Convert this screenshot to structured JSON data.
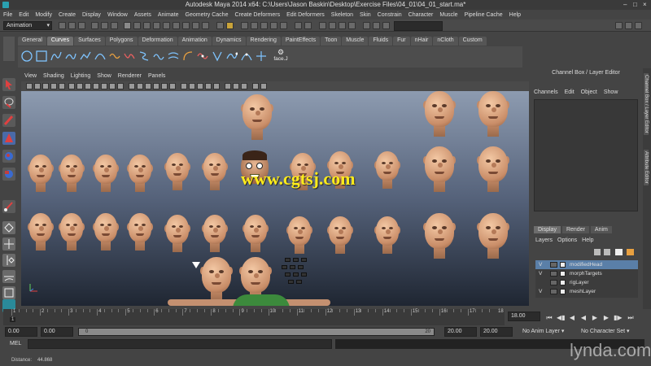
{
  "window": {
    "title": "Autodesk Maya 2014 x64: C:\\Users\\Jason Baskin\\Desktop\\Exercise Files\\04_01\\04_01_start.ma*"
  },
  "menubar": [
    "File",
    "Edit",
    "Modify",
    "Create",
    "Display",
    "Window",
    "Assets",
    "Animate",
    "Geometry Cache",
    "Create Deformers",
    "Edit Deformers",
    "Skeleton",
    "Skin",
    "Constrain",
    "Character",
    "Muscle",
    "Pipeline Cache",
    "Help"
  ],
  "statusline": {
    "mode": "Animation"
  },
  "shelf": {
    "tabs": [
      "General",
      "Curves",
      "Surfaces",
      "Polygons",
      "Deformation",
      "Animation",
      "Dynamics",
      "Rendering",
      "PaintEffects",
      "Toon",
      "Muscle",
      "Fluids",
      "Fur",
      "nHair",
      "nCloth",
      "Custom"
    ],
    "active_tab": "Curves",
    "last_item_label": "face.J"
  },
  "viewport": {
    "menu": [
      "View",
      "Shading",
      "Lighting",
      "Show",
      "Renderer",
      "Panels"
    ],
    "watermark": "www.cgtsj.com"
  },
  "channel_box": {
    "title": "Channel Box / Layer Editor",
    "menu": [
      "Channels",
      "Edit",
      "Object",
      "Show"
    ]
  },
  "layer_editor": {
    "tabs": [
      "Display",
      "Render",
      "Anim"
    ],
    "active_tab": "Display",
    "menu": [
      "Layers",
      "Options",
      "Help"
    ],
    "layers": [
      {
        "vis": "V",
        "name": "modifiedHead",
        "selected": true
      },
      {
        "vis": "V",
        "name": "morphTargets",
        "selected": false
      },
      {
        "vis": "",
        "name": "rigLayer",
        "selected": false
      },
      {
        "vis": "V",
        "name": "meshLayer",
        "selected": false
      }
    ]
  },
  "right_tabs": [
    "Channel Box / Layer Editor",
    "Attribute Editor"
  ],
  "timeline": {
    "tick_labels": [
      "1",
      "2",
      "3",
      "4",
      "5",
      "6",
      "7",
      "8",
      "9",
      "10",
      "11",
      "12",
      "13",
      "14",
      "15",
      "16",
      "17",
      "18"
    ],
    "current_frame_display": "1",
    "end_field": "18.00"
  },
  "range": {
    "start": "0.00",
    "playback_start": "0.00",
    "range_start_label": "0",
    "range_end_label": "20",
    "playback_end": "20.00",
    "end": "20.00",
    "anim_layer": "No Anim Layer",
    "character_set": "No Character Set"
  },
  "command_line": {
    "label": "MEL"
  },
  "help_line": {
    "label": "Distance:",
    "value": "44.868"
  },
  "branding": {
    "watermark": "lynda.com"
  }
}
